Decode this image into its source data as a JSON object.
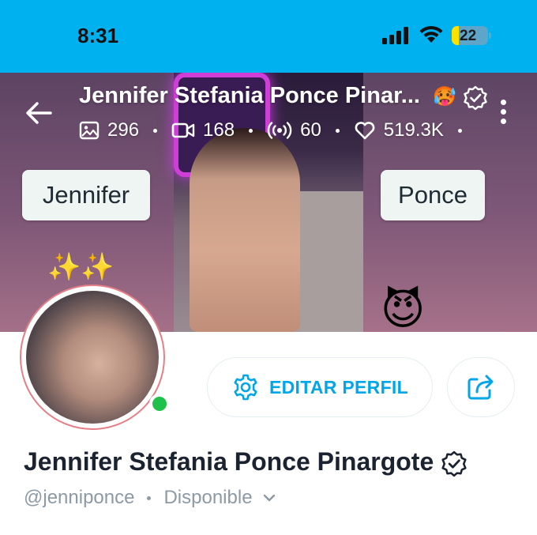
{
  "status_bar": {
    "time": "8:31",
    "battery": "22"
  },
  "header": {
    "title": "Jennifer Stefania Ponce Pinar...",
    "stats": [
      {
        "icon": "image-icon",
        "value": "296"
      },
      {
        "icon": "video-icon",
        "value": "168"
      },
      {
        "icon": "stream-icon",
        "value": "60"
      },
      {
        "icon": "heart-icon",
        "value": "519.3K"
      }
    ]
  },
  "banner": {
    "tag_left": "Jennifer",
    "tag_right": "Ponce"
  },
  "actions": {
    "edit_label": "EDITAR PERFIL"
  },
  "profile": {
    "name": "Jennifer Stefania Ponce Pinargote",
    "handle": "@jenniponce",
    "status": "Disponible"
  },
  "colors": {
    "status_bar": "#00b1f0",
    "accent": "#00a6e8",
    "online": "#1fc14a"
  }
}
